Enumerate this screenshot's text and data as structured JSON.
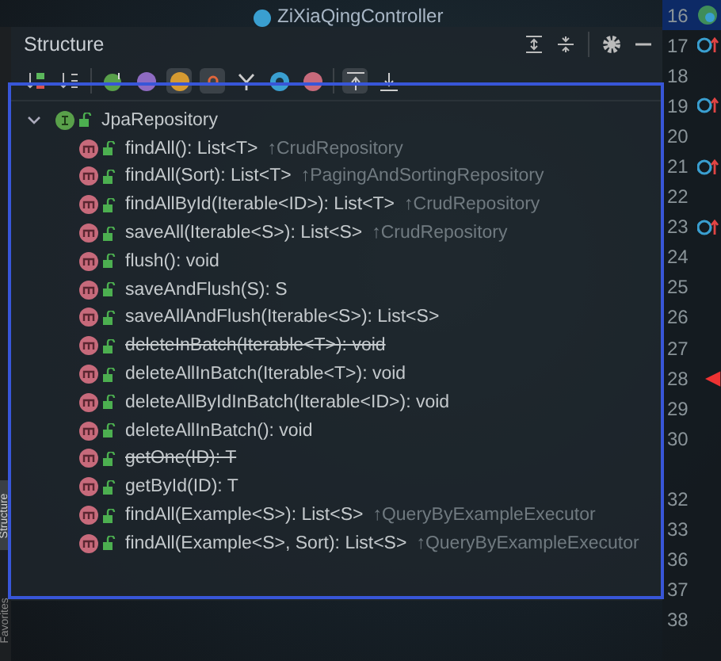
{
  "editor": {
    "class_name": "ZiXiaQingController"
  },
  "side_tabs": [
    {
      "label": "Structure",
      "selected": true
    },
    {
      "label": "Favorites",
      "selected": false
    }
  ],
  "panel": {
    "title": "Structure"
  },
  "toolbar": [
    {
      "kind": "sort-visibility",
      "selected": false
    },
    {
      "kind": "sort-alpha",
      "selected": false
    },
    {
      "kind": "inherited",
      "selected": false
    },
    {
      "kind": "properties",
      "selected": false
    },
    {
      "kind": "fields",
      "selected": true
    },
    {
      "kind": "non-public",
      "selected": true
    },
    {
      "kind": "fork",
      "selected": false
    },
    {
      "kind": "anonymous",
      "selected": false
    },
    {
      "kind": "lambdas",
      "selected": false
    },
    {
      "kind": "expand",
      "selected": true
    },
    {
      "kind": "collapse",
      "selected": false
    }
  ],
  "tree": {
    "label": "JpaRepository",
    "expanded": true,
    "children": [
      {
        "signature": "findAll(): List<T>",
        "origin": "↑CrudRepository",
        "deprecated": false
      },
      {
        "signature": "findAll(Sort): List<T>",
        "origin": "↑PagingAndSortingRepository",
        "deprecated": false
      },
      {
        "signature": "findAllById(Iterable<ID>): List<T>",
        "origin": "↑CrudRepository",
        "deprecated": false
      },
      {
        "signature": "saveAll(Iterable<S>): List<S>",
        "origin": "↑CrudRepository",
        "deprecated": false
      },
      {
        "signature": "flush(): void",
        "deprecated": false
      },
      {
        "signature": "saveAndFlush(S): S",
        "deprecated": false
      },
      {
        "signature": "saveAllAndFlush(Iterable<S>): List<S>",
        "deprecated": false
      },
      {
        "signature": "deleteInBatch(Iterable<T>): void",
        "deprecated": true
      },
      {
        "signature": "deleteAllInBatch(Iterable<T>): void",
        "deprecated": false
      },
      {
        "signature": "deleteAllByIdInBatch(Iterable<ID>): void",
        "deprecated": false
      },
      {
        "signature": "deleteAllInBatch(): void",
        "deprecated": false
      },
      {
        "signature": "getOne(ID): T",
        "deprecated": true
      },
      {
        "signature": "getById(ID): T",
        "deprecated": false
      },
      {
        "signature": "findAll(Example<S>): List<S>",
        "origin": "↑QueryByExampleExecutor",
        "deprecated": false
      },
      {
        "signature": "findAll(Example<S>, Sort): List<S>",
        "origin": "↑QueryByExampleExecutor",
        "deprecated": false
      }
    ]
  },
  "gutter": [
    {
      "number": "16",
      "kind": "leaf",
      "selected": true
    },
    {
      "number": "17",
      "kind": "override",
      "selected": false
    },
    {
      "number": "18",
      "selected": false
    },
    {
      "number": "19",
      "kind": "override",
      "selected": false
    },
    {
      "number": "20",
      "selected": false
    },
    {
      "number": "21",
      "kind": "override",
      "selected": false
    },
    {
      "number": "22",
      "selected": false
    },
    {
      "number": "23",
      "kind": "override",
      "selected": false
    },
    {
      "number": "24",
      "selected": false
    },
    {
      "number": "25",
      "selected": false
    },
    {
      "number": "26",
      "selected": false
    },
    {
      "number": "27",
      "selected": false
    },
    {
      "number": "28",
      "kind": "breakpoint",
      "selected": false
    },
    {
      "number": "29",
      "selected": false
    },
    {
      "number": "30",
      "selected": false
    },
    {
      "kind": "blank",
      "selected": false
    },
    {
      "number": "32",
      "selected": false
    },
    {
      "number": "33",
      "selected": false
    },
    {
      "number": "36",
      "selected": false
    },
    {
      "number": "37",
      "selected": false
    },
    {
      "number": "38",
      "selected": false
    }
  ]
}
